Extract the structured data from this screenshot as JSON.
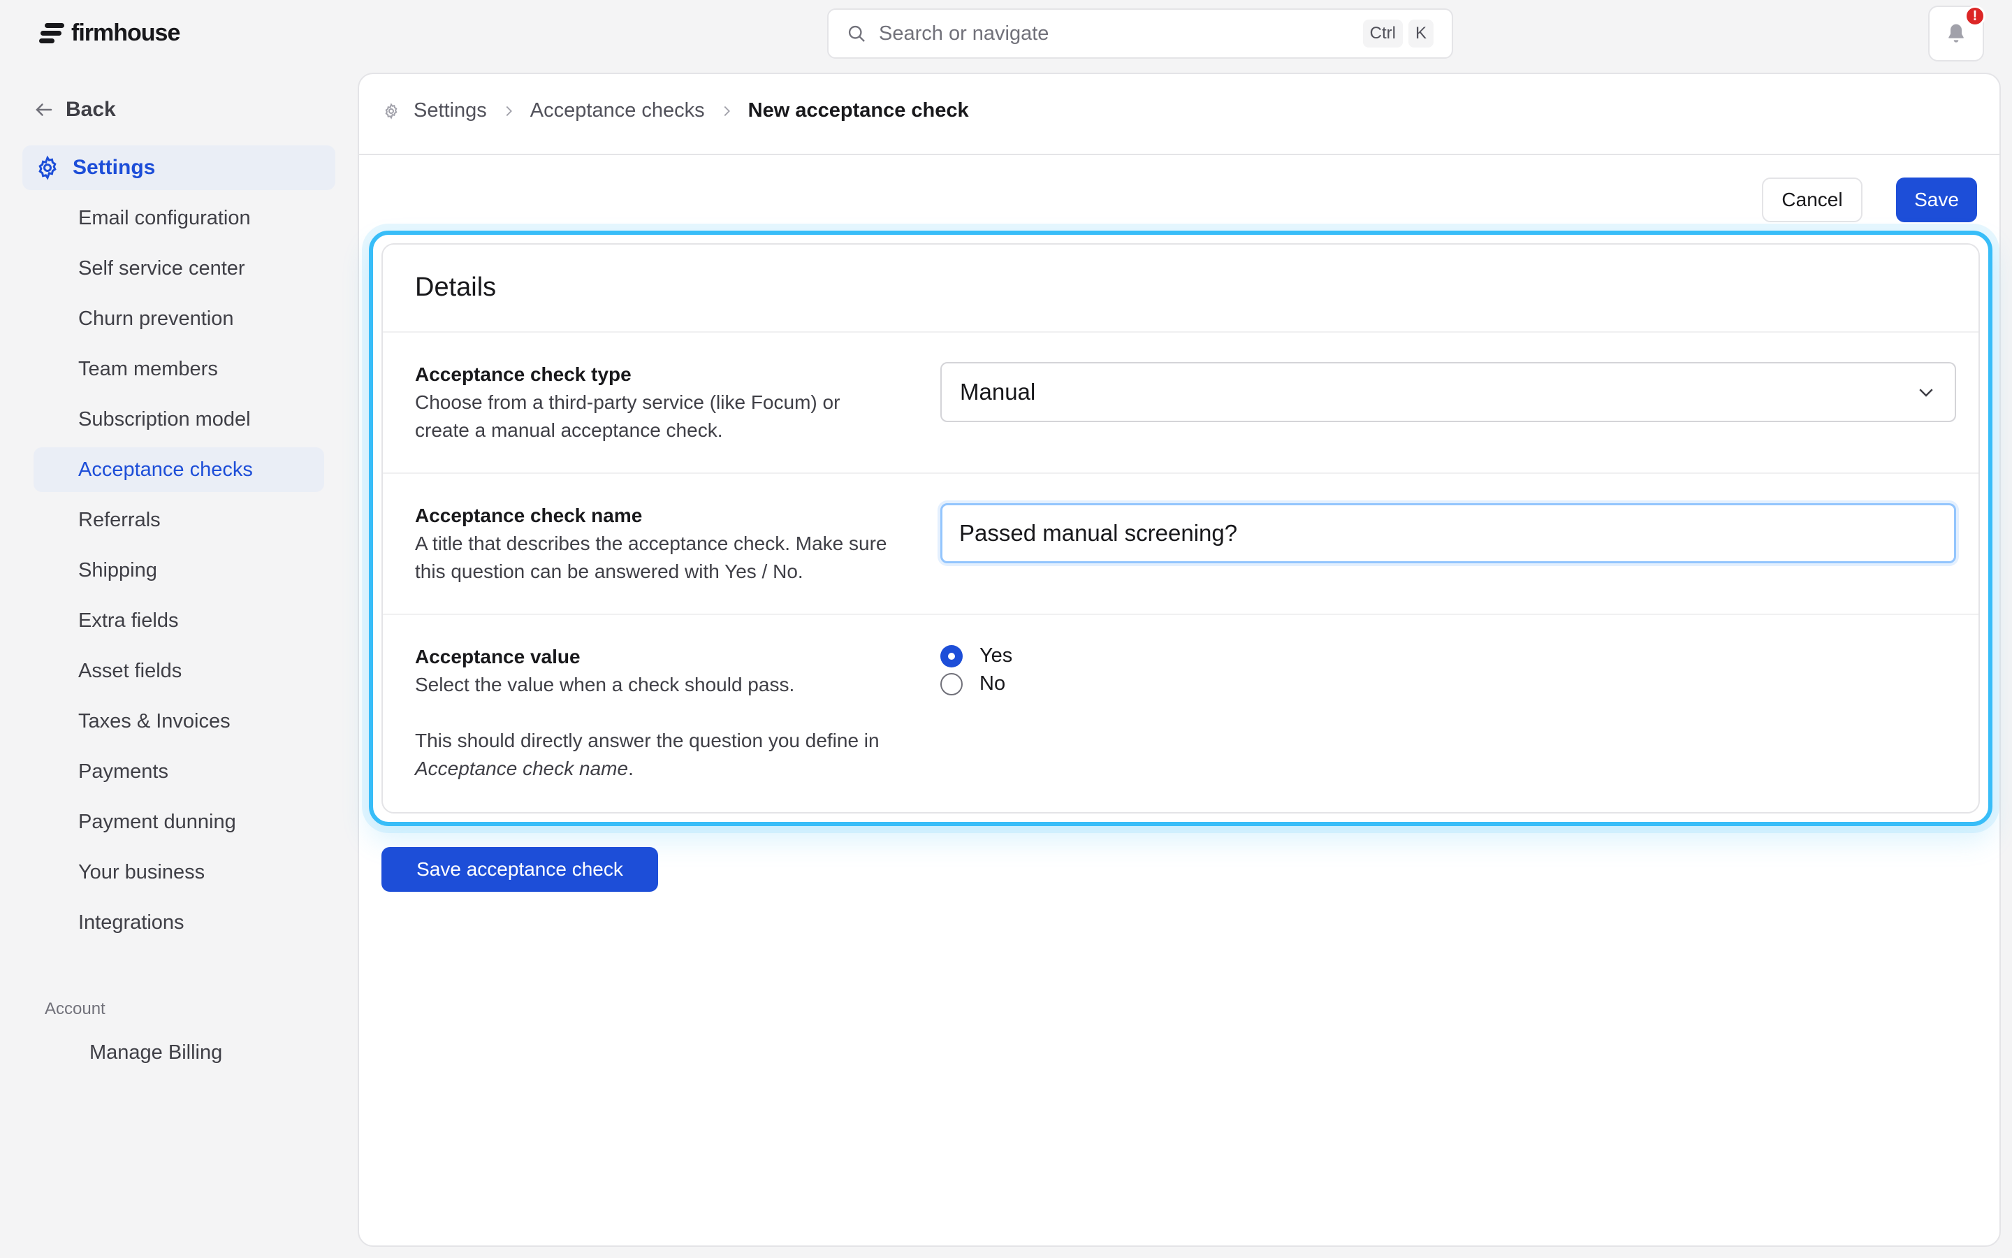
{
  "app": {
    "name": "firmhouse",
    "logo_icon": "firmhouse-logo-icon"
  },
  "search": {
    "placeholder": "Search or navigate",
    "shortcut_ctrl": "Ctrl",
    "shortcut_key": "K"
  },
  "notifications": {
    "badge": "!"
  },
  "sidebar": {
    "back_label": "Back",
    "section_label": "Settings",
    "items": [
      {
        "label": "Email configuration"
      },
      {
        "label": "Self service center"
      },
      {
        "label": "Churn prevention"
      },
      {
        "label": "Team members"
      },
      {
        "label": "Subscription model"
      },
      {
        "label": "Acceptance checks",
        "active": true
      },
      {
        "label": "Referrals"
      },
      {
        "label": "Shipping"
      },
      {
        "label": "Extra fields"
      },
      {
        "label": "Asset fields"
      },
      {
        "label": "Taxes & Invoices"
      },
      {
        "label": "Payments"
      },
      {
        "label": "Payment dunning"
      },
      {
        "label": "Your business"
      },
      {
        "label": "Integrations"
      }
    ],
    "account_label": "Account",
    "manage_billing": "Manage Billing"
  },
  "breadcrumb": [
    "Settings",
    "Acceptance checks",
    "New acceptance check"
  ],
  "toolbar": {
    "cancel_label": "Cancel",
    "save_label": "Save"
  },
  "form": {
    "title": "Details",
    "type": {
      "label": "Acceptance check type",
      "help": "Choose from a third-party service (like Focum) or create a manual acceptance check.",
      "value": "Manual"
    },
    "name": {
      "label": "Acceptance check name",
      "help": "A title that describes the acceptance check. Make sure this question can be answered with Yes / No.",
      "value": "Passed manual screening?"
    },
    "value": {
      "label": "Acceptance value",
      "help": "Select the value when a check should pass.",
      "note_prefix": "This should directly answer the question you define in ",
      "note_em": "Acceptance check name",
      "note_suffix": ".",
      "options": [
        {
          "label": "Yes",
          "selected": true
        },
        {
          "label": "No",
          "selected": false
        }
      ]
    },
    "submit_label": "Save acceptance check"
  },
  "colors": {
    "accent": "#1d4ed8",
    "focus_ring": "#38bdf8",
    "badge": "#dc2626"
  }
}
